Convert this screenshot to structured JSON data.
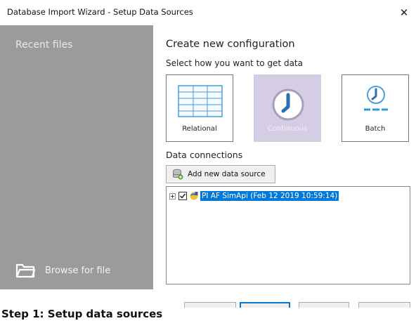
{
  "window": {
    "title": "Database Import Wizard - Setup Data Sources",
    "close_glyph": "✕"
  },
  "sidebar": {
    "recent_label": "Recent files",
    "browse_label": "Browse for file",
    "background": "#9b9b9b"
  },
  "main": {
    "heading": "Create new configuration",
    "subheading": "Select how you want to get data",
    "tiles": [
      {
        "label": "Relational",
        "icon": "table-icon",
        "selected": false
      },
      {
        "label": "Continuous",
        "icon": "clock-icon",
        "selected": true
      },
      {
        "label": "Batch",
        "icon": "batch-clock-icon",
        "selected": false
      }
    ],
    "connections_heading": "Data connections",
    "add_button_label": "Add new data source",
    "tree": {
      "items": [
        {
          "label": "PI AF SimApi (Feb 12 2019 10:59:14)",
          "checked": true,
          "selected": true
        }
      ]
    }
  },
  "caption": "Step 1: Setup data sources",
  "colors": {
    "accent": "#0078d7",
    "selected_tile": "#d5cde3",
    "icon_blue": "#2b6fb4",
    "dash_blue": "#2b9ad8"
  }
}
